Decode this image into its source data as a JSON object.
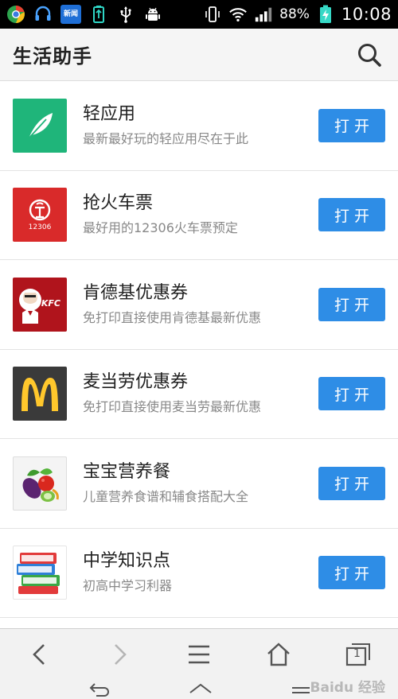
{
  "status_bar": {
    "battery_percent": "88%",
    "time": "10:08",
    "news_badge": "新闻",
    "icons": [
      "chrome-icon",
      "headset-icon",
      "news-icon",
      "usb-battery-icon",
      "usb-icon",
      "android-debug-icon",
      "vibrate-icon",
      "wifi-icon",
      "signal-icon",
      "battery-charging-icon"
    ]
  },
  "header": {
    "title": "生活助手",
    "search_icon": "search-icon"
  },
  "apps": [
    {
      "title": "轻应用",
      "subtitle": "最新最好玩的轻应用尽在于此",
      "button": "打开",
      "icon": "feather-icon",
      "icon_bg": "#1fb57a"
    },
    {
      "title": "抢火车票",
      "subtitle": "最好用的12306火车票预定",
      "button": "打开",
      "icon": "railway-12306-icon",
      "icon_bg": "#d92a2a",
      "icon_text": "12306"
    },
    {
      "title": "肯德基优惠券",
      "subtitle": "免打印直接使用肯德基最新优惠",
      "button": "打开",
      "icon": "kfc-icon",
      "icon_bg": "#b0141c",
      "icon_text": "KFC"
    },
    {
      "title": "麦当劳优惠券",
      "subtitle": "免打印直接使用麦当劳最新优惠",
      "button": "打开",
      "icon": "mcdonalds-icon",
      "icon_bg": "#3a3a3a"
    },
    {
      "title": "宝宝营养餐",
      "subtitle": "儿童营养食谱和辅食搭配大全",
      "button": "打开",
      "icon": "vegetables-icon",
      "icon_bg": "#f4f4f4"
    },
    {
      "title": "中学知识点",
      "subtitle": "初高中学习利器",
      "button": "打开",
      "icon": "books-icon",
      "icon_bg": "#ffffff"
    }
  ],
  "bottom_nav": {
    "items": [
      "back-icon",
      "forward-icon",
      "menu-icon",
      "home-icon",
      "tabs-icon"
    ],
    "tabs_count": "1"
  },
  "system_bar": {
    "items": [
      "system-back-icon",
      "system-home-icon",
      "system-menu-icon"
    ]
  },
  "watermark": "Baidu 经验",
  "colors": {
    "accent": "#2e8de6",
    "header_bg": "#f5f5f5",
    "status_bg": "#000000"
  }
}
